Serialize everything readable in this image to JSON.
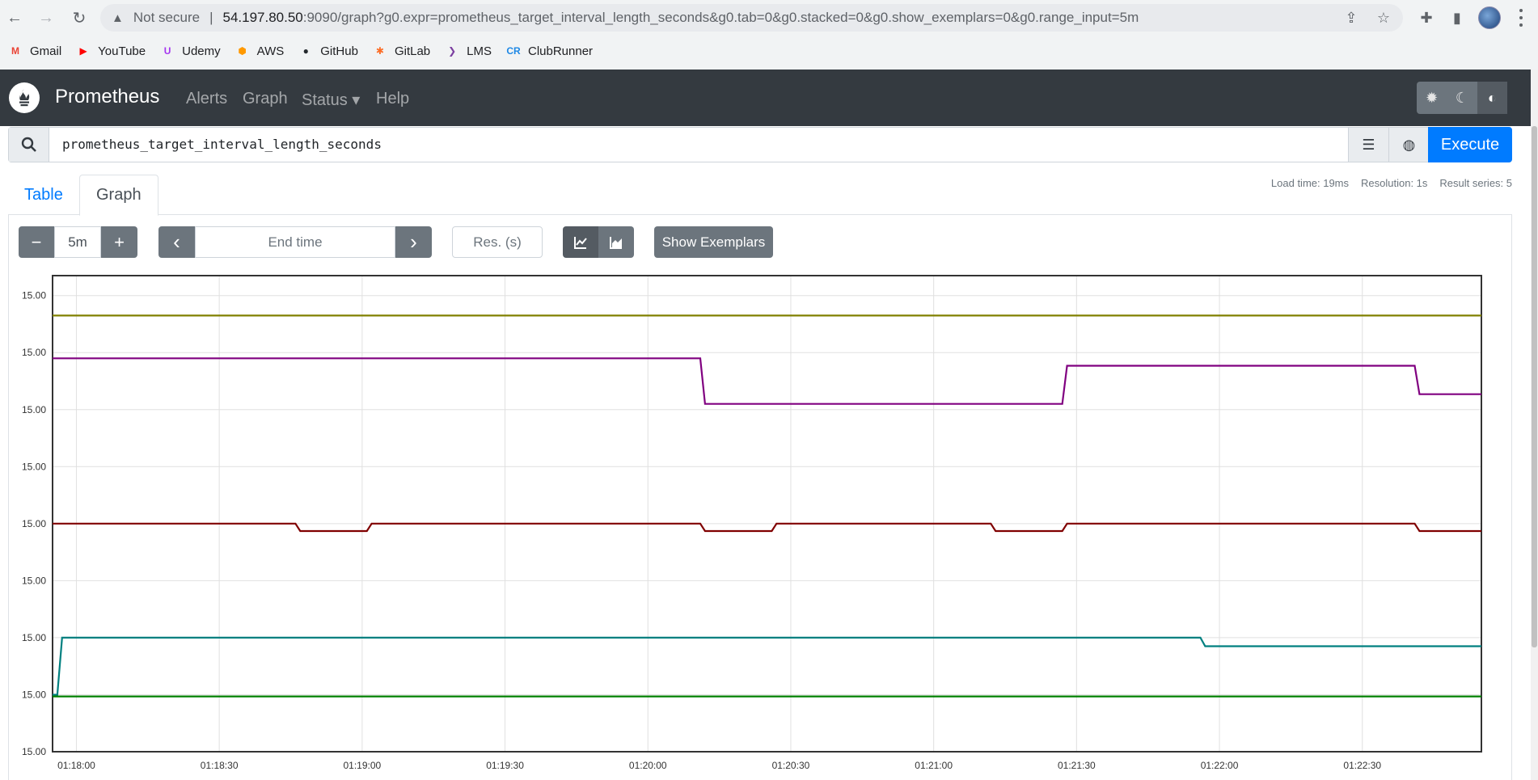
{
  "browser": {
    "url_security": "Not secure",
    "url_host": "54.197.80.50",
    "url_path": ":9090/graph?g0.expr=prometheus_target_interval_length_seconds&g0.tab=0&g0.stacked=0&g0.show_exemplars=0&g0.range_input=5m",
    "bookmarks": [
      {
        "label": "Gmail",
        "icon": "gmail-icon",
        "color": "#ea4335",
        "glyph": "M"
      },
      {
        "label": "YouTube",
        "icon": "youtube-icon",
        "color": "#ff0000",
        "glyph": "▶"
      },
      {
        "label": "Udemy",
        "icon": "udemy-icon",
        "color": "#a435f0",
        "glyph": "U"
      },
      {
        "label": "AWS",
        "icon": "aws-icon",
        "color": "#ff9900",
        "glyph": "⬢"
      },
      {
        "label": "GitHub",
        "icon": "github-icon",
        "color": "#24292e",
        "glyph": "●"
      },
      {
        "label": "GitLab",
        "icon": "gitlab-icon",
        "color": "#fc6d26",
        "glyph": "✱"
      },
      {
        "label": "LMS",
        "icon": "lms-icon",
        "color": "#7b3fa0",
        "glyph": "❯"
      },
      {
        "label": "ClubRunner",
        "icon": "clubrunner-icon",
        "color": "#1e88e5",
        "glyph": "CR"
      }
    ]
  },
  "navbar": {
    "brand": "Prometheus",
    "links": [
      {
        "label": "Alerts",
        "x": 230
      },
      {
        "label": "Graph",
        "x": 300
      },
      {
        "label": "Status ▾",
        "x": 373
      },
      {
        "label": "Help",
        "x": 465
      }
    ]
  },
  "expression": {
    "query": "prometheus_target_interval_length_seconds",
    "execute_label": "Execute"
  },
  "tabs": {
    "table": "Table",
    "graph": "Graph"
  },
  "stats": {
    "load_time": "Load time: 19ms",
    "resolution": "Resolution: 1s",
    "result_series": "Result series: 5"
  },
  "controls": {
    "minus": "−",
    "range": "5m",
    "plus": "+",
    "prev": "‹",
    "end_time_placeholder": "End time",
    "next": "›",
    "res_placeholder": "Res. (s)",
    "show_exemplars": "Show Exemplars"
  },
  "chart_data": {
    "type": "line",
    "x_ticks": [
      "01:18:00",
      "01:18:30",
      "01:19:00",
      "01:19:30",
      "01:20:00",
      "01:20:30",
      "01:21:00",
      "01:21:30",
      "01:22:00",
      "01:22:30"
    ],
    "y_ticks": [
      "15.00",
      "15.00",
      "15.00",
      "15.00",
      "15.00",
      "15.00",
      "15.00",
      "15.00",
      "15.00"
    ],
    "x_start": "01:17:55",
    "x_end": "01:22:55",
    "grid": true,
    "series": [
      {
        "color": "#808000",
        "points": [
          [
            "01:17:55",
            7.65
          ],
          [
            "01:22:55",
            7.65
          ]
        ]
      },
      {
        "color": "#800080",
        "points": [
          [
            "01:17:55",
            6.9
          ],
          [
            "01:20:11",
            6.9
          ],
          [
            "01:20:12",
            6.1
          ],
          [
            "01:21:27",
            6.1
          ],
          [
            "01:21:28",
            6.77
          ],
          [
            "01:22:41",
            6.77
          ],
          [
            "01:22:42",
            6.27
          ],
          [
            "01:22:55",
            6.27
          ]
        ]
      },
      {
        "color": "#800000",
        "points": [
          [
            "01:17:55",
            4.0
          ],
          [
            "01:18:46",
            4.0
          ],
          [
            "01:18:47",
            3.87
          ],
          [
            "01:19:01",
            3.87
          ],
          [
            "01:19:02",
            4.0
          ],
          [
            "01:20:11",
            4.0
          ],
          [
            "01:20:12",
            3.87
          ],
          [
            "01:20:26",
            3.87
          ],
          [
            "01:20:27",
            4.0
          ],
          [
            "01:21:12",
            4.0
          ],
          [
            "01:21:13",
            3.87
          ],
          [
            "01:21:27",
            3.87
          ],
          [
            "01:21:28",
            4.0
          ],
          [
            "01:22:41",
            4.0
          ],
          [
            "01:22:42",
            3.87
          ],
          [
            "01:22:55",
            3.87
          ]
        ]
      },
      {
        "color": "#008080",
        "points": [
          [
            "01:17:55",
            1.0
          ],
          [
            "01:17:56",
            1.0
          ],
          [
            "01:17:57",
            2.0
          ],
          [
            "01:21:56",
            2.0
          ],
          [
            "01:21:57",
            1.85
          ],
          [
            "01:22:55",
            1.85
          ]
        ]
      },
      {
        "color": "#008000",
        "points": [
          [
            "01:17:55",
            0.97
          ],
          [
            "01:22:55",
            0.97
          ]
        ]
      }
    ]
  }
}
